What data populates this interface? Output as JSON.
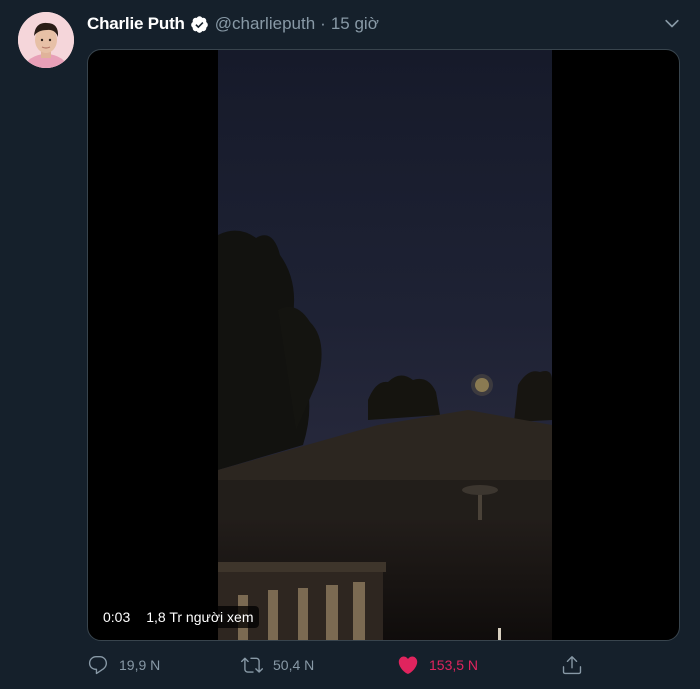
{
  "author": {
    "display_name": "Charlie Puth",
    "handle": "@charlieputh",
    "separator": "·",
    "time_ago": "15 giờ",
    "verified": true
  },
  "media": {
    "type": "video",
    "elapsed": "0:03",
    "views": "1,8 Tr người xem"
  },
  "actions": {
    "reply_count": "19,9 N",
    "retweet_count": "50,4 N",
    "like_count": "153,5 N",
    "liked": true
  },
  "colors": {
    "background": "#15202b",
    "secondary_text": "#8899a6",
    "verified": "#ffffff",
    "like": "#e0245e",
    "border": "#38444d"
  }
}
